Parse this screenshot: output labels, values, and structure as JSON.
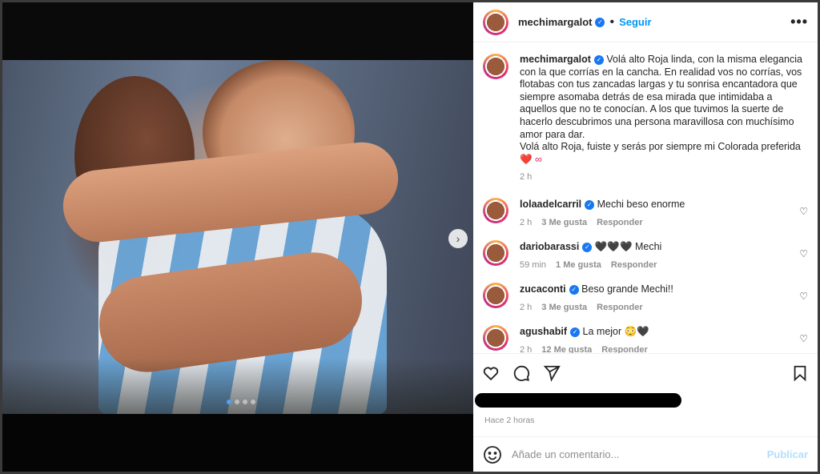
{
  "post": {
    "username": "mechimargalot",
    "follow_label": "Seguir",
    "separator": "•",
    "more_label": "•••",
    "caption": "Volá alto Roja linda, con la misma elegancia con la que corrías en la cancha. En realidad vos no corrías, vos flotabas con tus zancadas largas y tu sonrisa encantadora que siempre asomaba detrás de esa mirada que intimidaba a aquellos que no te conocían. A los que tuvimos la suerte de hacerlo descubrimos una persona maravillosa con muchísimo amor para dar.",
    "caption_line2": "Volá alto Roja, fuiste y serás por siempre mi Colorada preferida",
    "caption_emojis": "❤️ ∞",
    "caption_time": "2 h",
    "posted_ago": "Hace 2 horas"
  },
  "comments": [
    {
      "username": "lolaadelcarril",
      "text": "Mechi beso enorme",
      "time": "2 h",
      "likes": "3 Me gusta",
      "reply": "Responder"
    },
    {
      "username": "dariobarassi",
      "text": "🖤🖤🖤 Mechi",
      "time": "59 min",
      "likes": "1 Me gusta",
      "reply": "Responder"
    },
    {
      "username": "zucaconti",
      "text": "Beso grande Mechi!!",
      "time": "2 h",
      "likes": "3 Me gusta",
      "reply": "Responder"
    },
    {
      "username": "agushabif",
      "text": "La mejor 😳🖤",
      "time": "2 h",
      "likes": "12 Me gusta",
      "reply": "Responder"
    }
  ],
  "composer": {
    "placeholder": "Añade un comentario...",
    "publish_label": "Publicar"
  },
  "icons": {
    "next": "chevron-right-icon",
    "like": "heart-icon",
    "comment": "comment-icon",
    "share": "paper-plane-icon",
    "save": "bookmark-icon",
    "emoji": "smiley-icon"
  },
  "colors": {
    "accent": "#0095f6",
    "verified": "#1877f2",
    "publish_disabled": "#b2dffc",
    "carousel_active": "#4fa3f7"
  },
  "carousel": {
    "count": 4,
    "active": 1
  }
}
